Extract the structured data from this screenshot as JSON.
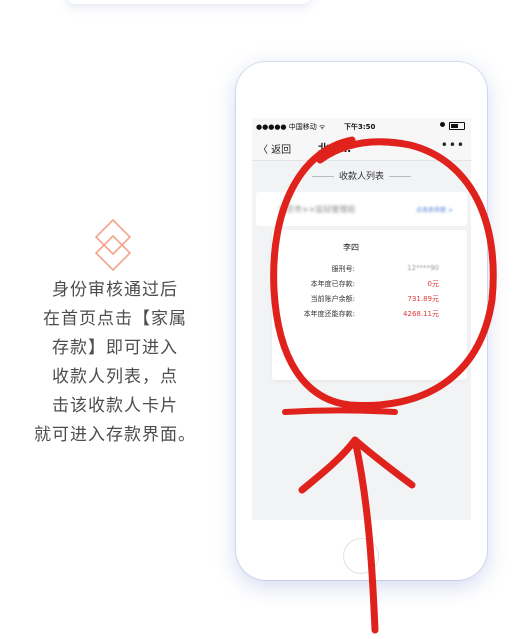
{
  "caption": {
    "lines": [
      "身份审核通过后",
      "在首页点击【家属",
      "存款】即可进入",
      "收款人列表，点",
      "击该收款人卡片",
      "就可进入存款界面。"
    ]
  },
  "phone": {
    "status_bar": {
      "carrier": "●●●●● 中国移动 ᯤ",
      "time": "下午3:50"
    },
    "nav": {
      "back_label": "〈 返回",
      "title": "北京…",
      "more_label": "•••"
    },
    "list_header": "收款人列表",
    "blurred_card": {
      "text": "北京市××监狱管理局",
      "link": "点击去存款 >"
    },
    "payee_card": {
      "name": "李四",
      "rows": [
        {
          "label": "服刑号:",
          "value": "12****90"
        },
        {
          "label": "本年度已存款:",
          "value": "0元"
        },
        {
          "label": "当前账户余额:",
          "value": "731.89元"
        },
        {
          "label": "本年度还能存款:",
          "value": "4268.11元"
        }
      ]
    }
  },
  "colors": {
    "annotation_red": "#e0221c",
    "accent_orange": "#f0a488",
    "value_red": "#e03a3a"
  },
  "icons": [
    "diamond-icon",
    "arrow-up-annotation",
    "circle-annotation"
  ]
}
